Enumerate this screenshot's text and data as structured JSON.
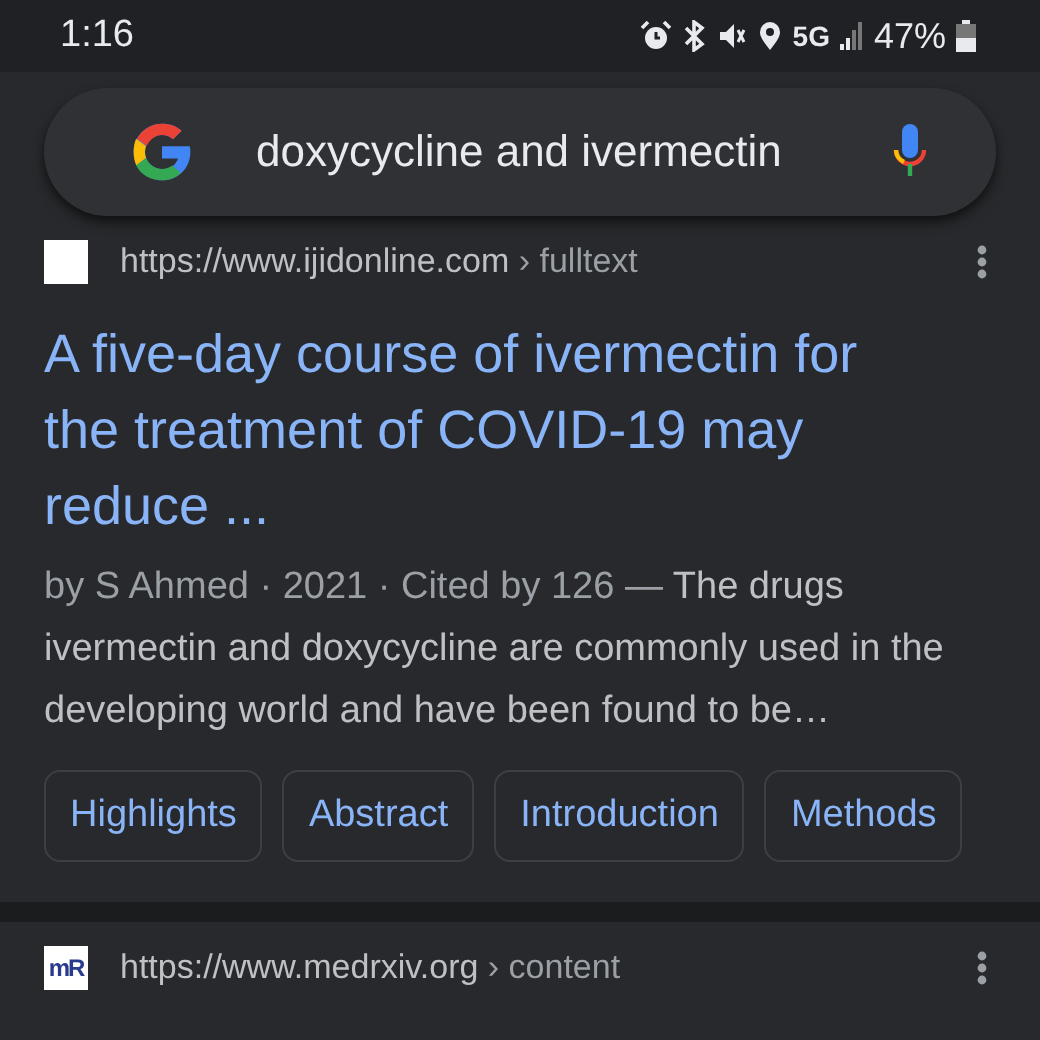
{
  "status_bar": {
    "time": "1:16",
    "network": "5G",
    "battery": "47%"
  },
  "search": {
    "value": "doxycycline and ivermectin"
  },
  "results": [
    {
      "favicon": {
        "kind": "blank"
      },
      "url": "https://www.ijidonline.com",
      "path": "› fulltext",
      "title": "A five-day course of ivermectin for the treatment of COVID-19 may reduce ...",
      "meta": "by S Ahmed · 2021 · Cited by 126 — ",
      "snippet": "The drugs ivermectin and doxycycline are commonly used in the developing world and have been found to be…",
      "chips": [
        "Highlights",
        "Abstract",
        "Introduction",
        "Methods"
      ]
    },
    {
      "favicon": {
        "kind": "text",
        "text": "mR"
      },
      "url": "https://www.medrxiv.org",
      "path": "› content"
    }
  ]
}
